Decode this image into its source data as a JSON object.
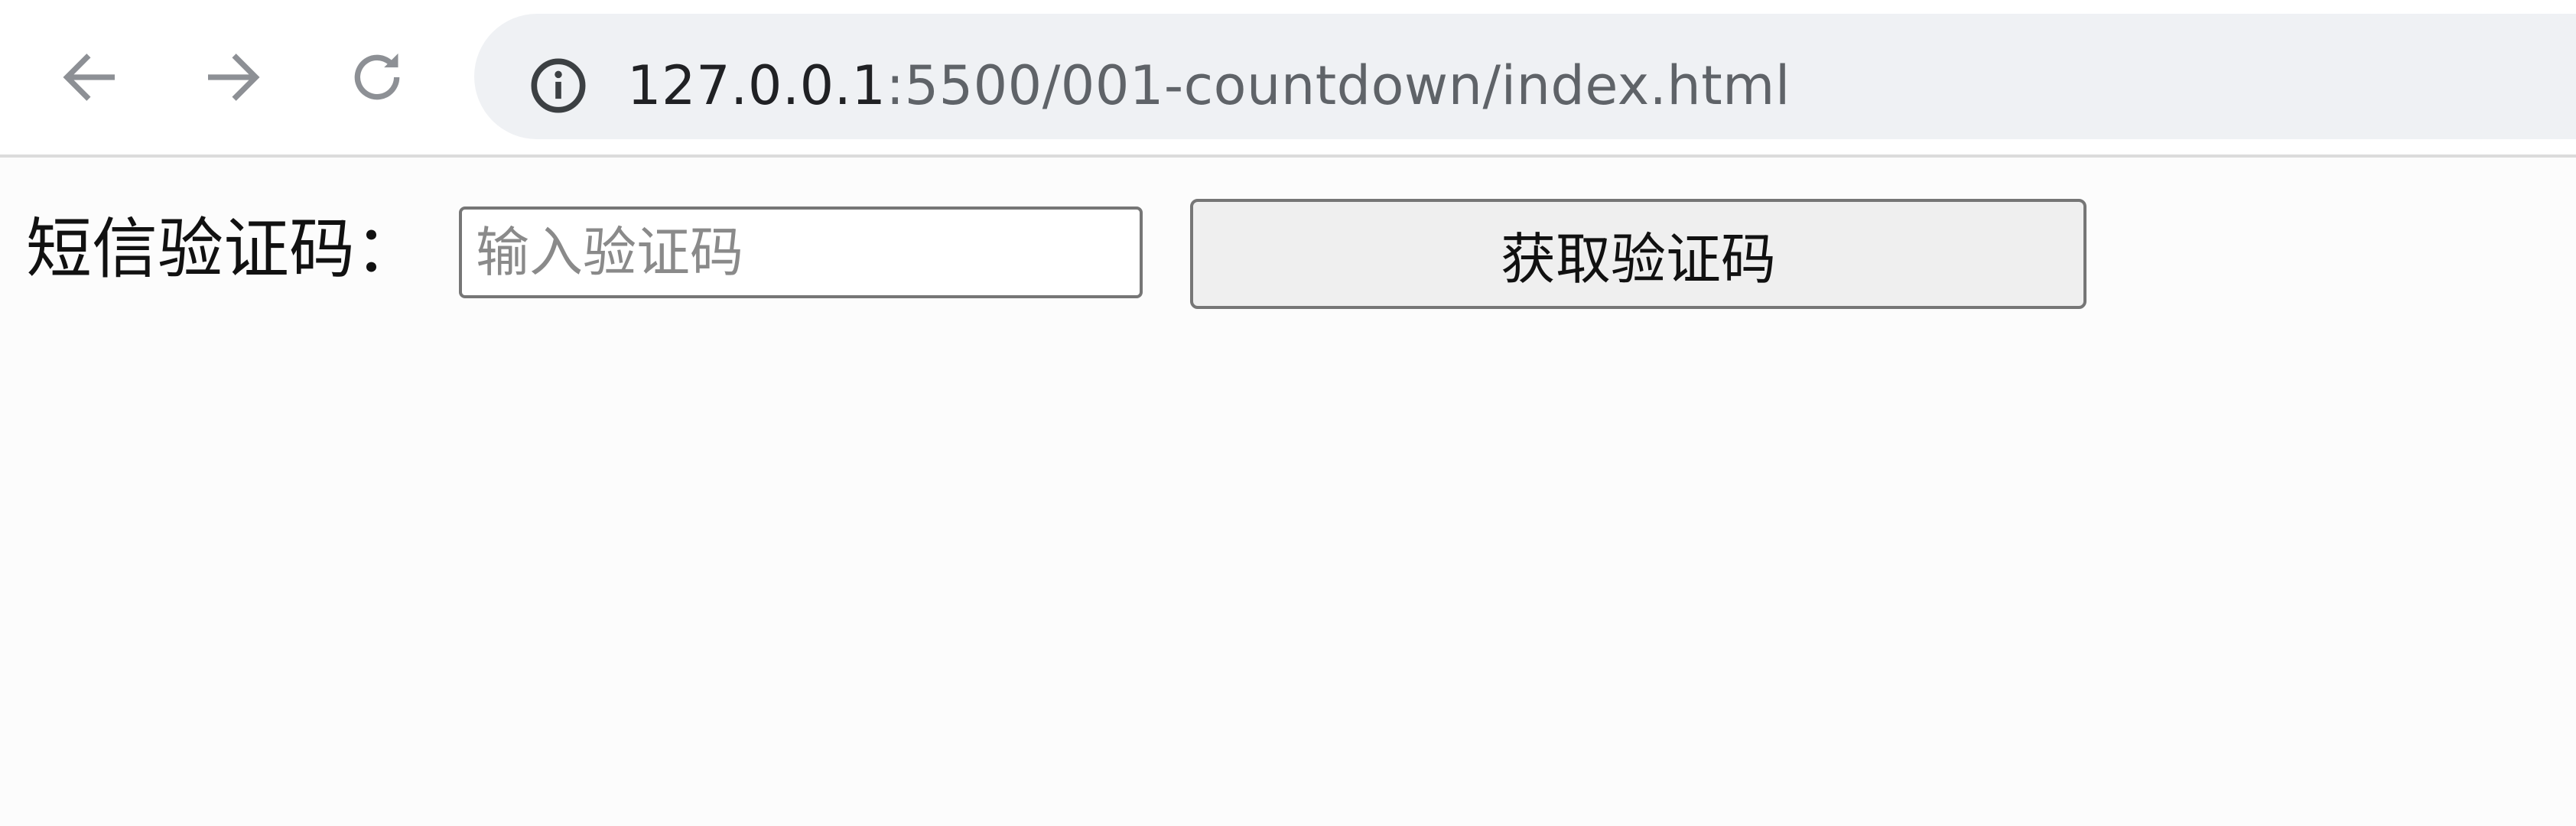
{
  "browser": {
    "url_host": "127.0.0.1",
    "url_path": ":5500/001-countdown/index.html",
    "icons": {
      "back": "back-arrow-icon",
      "forward": "forward-arrow-icon",
      "reload": "reload-icon",
      "site_info": "info-icon"
    }
  },
  "form": {
    "label": "短信验证码：",
    "input_value": "",
    "input_placeholder": "输入验证码",
    "button_label": "获取验证码"
  },
  "colors": {
    "toolbar_bg": "#ffffff",
    "omnibox_bg": "#eff1f4",
    "page_bg": "#fcfcfc",
    "button_bg": "#efefef",
    "border": "#767676"
  }
}
